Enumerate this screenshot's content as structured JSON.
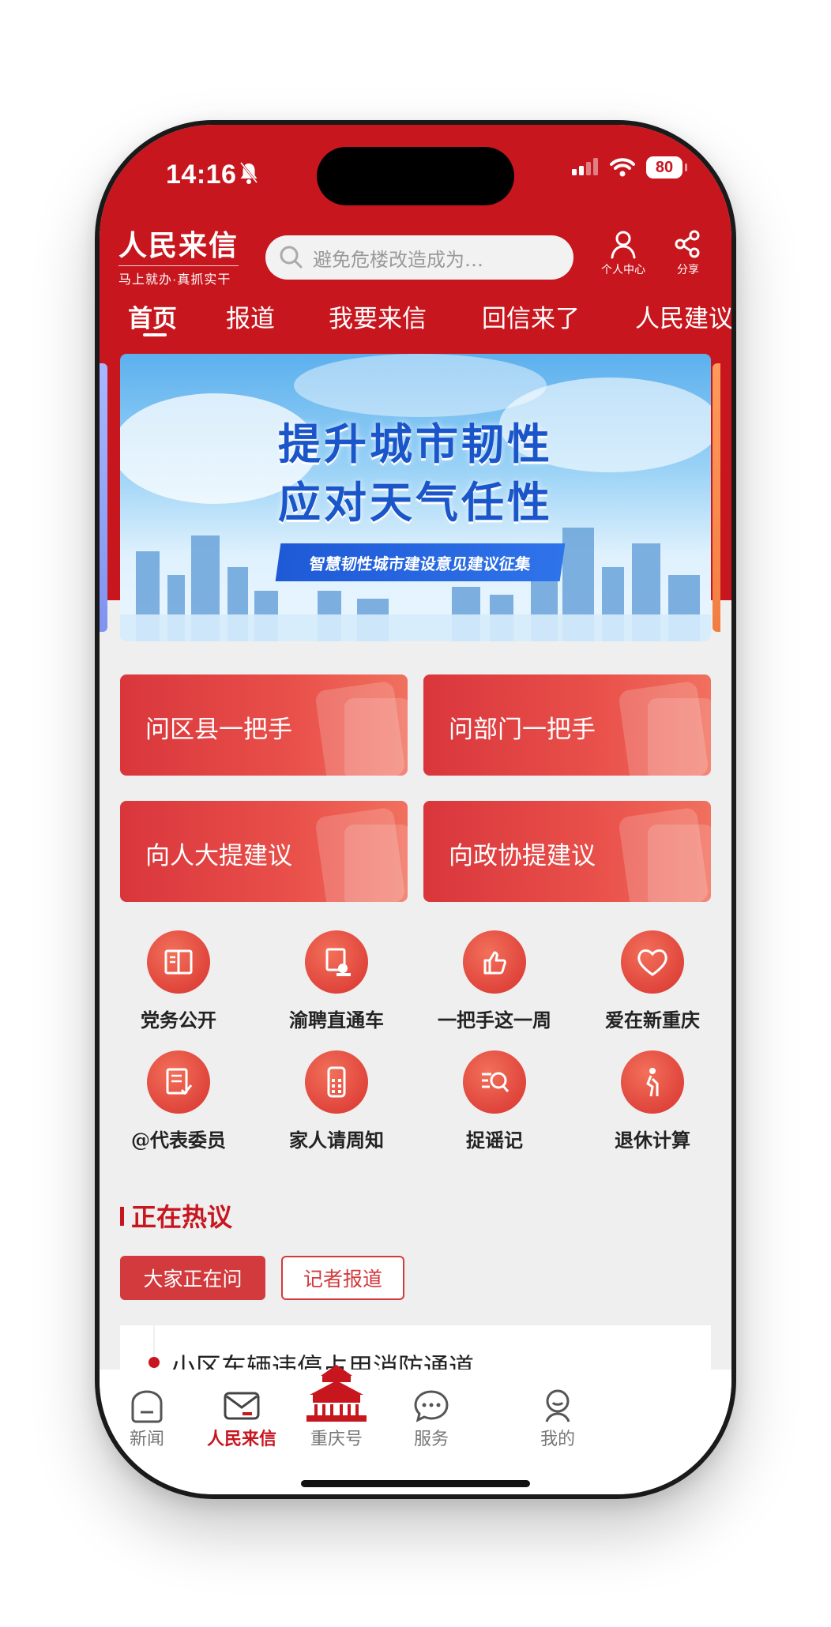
{
  "status": {
    "time": "14:16",
    "battery": "80"
  },
  "header": {
    "brand_title": "人民来信",
    "brand_subtitle": "马上就办·真抓实干",
    "search_placeholder": "避免危楼改造成为…",
    "profile_label": "个人中心",
    "share_label": "分享"
  },
  "tabs": [
    "首页",
    "报道",
    "我要来信",
    "回信来了",
    "人民建议"
  ],
  "banner": {
    "line1": "提升城市韧性",
    "line2": "应对天气任性",
    "ribbon": "智慧韧性城市建设意见建议征集"
  },
  "cards": [
    "问区县一把手",
    "问部门一把手",
    "向人大提建议",
    "向政协提建议"
  ],
  "services": [
    {
      "label": "党务公开",
      "icon": "book-icon"
    },
    {
      "label": "渝聘直通车",
      "icon": "recruit-icon"
    },
    {
      "label": "一把手这一周",
      "icon": "thumbs-up-icon"
    },
    {
      "label": "爱在新重庆",
      "icon": "heart-icon",
      "icon_text": "爱在新重庆"
    },
    {
      "label": "@代表委员",
      "icon": "document-edit-icon"
    },
    {
      "label": "家人请周知",
      "icon": "phone-icon"
    },
    {
      "label": "捉谣记",
      "icon": "search-list-icon"
    },
    {
      "label": "退休计算",
      "icon": "elder-icon"
    }
  ],
  "hot": {
    "title": "正在热议",
    "pill_active": "大家正在问",
    "pill_inactive": "记者报道",
    "first_item": "小区车辆违停占用消防通道"
  },
  "tabbar": [
    "新闻",
    "人民来信",
    "重庆号",
    "服务",
    "我的"
  ],
  "colors": {
    "brand_red": "#c8161e",
    "card_red": "#e9504a"
  }
}
